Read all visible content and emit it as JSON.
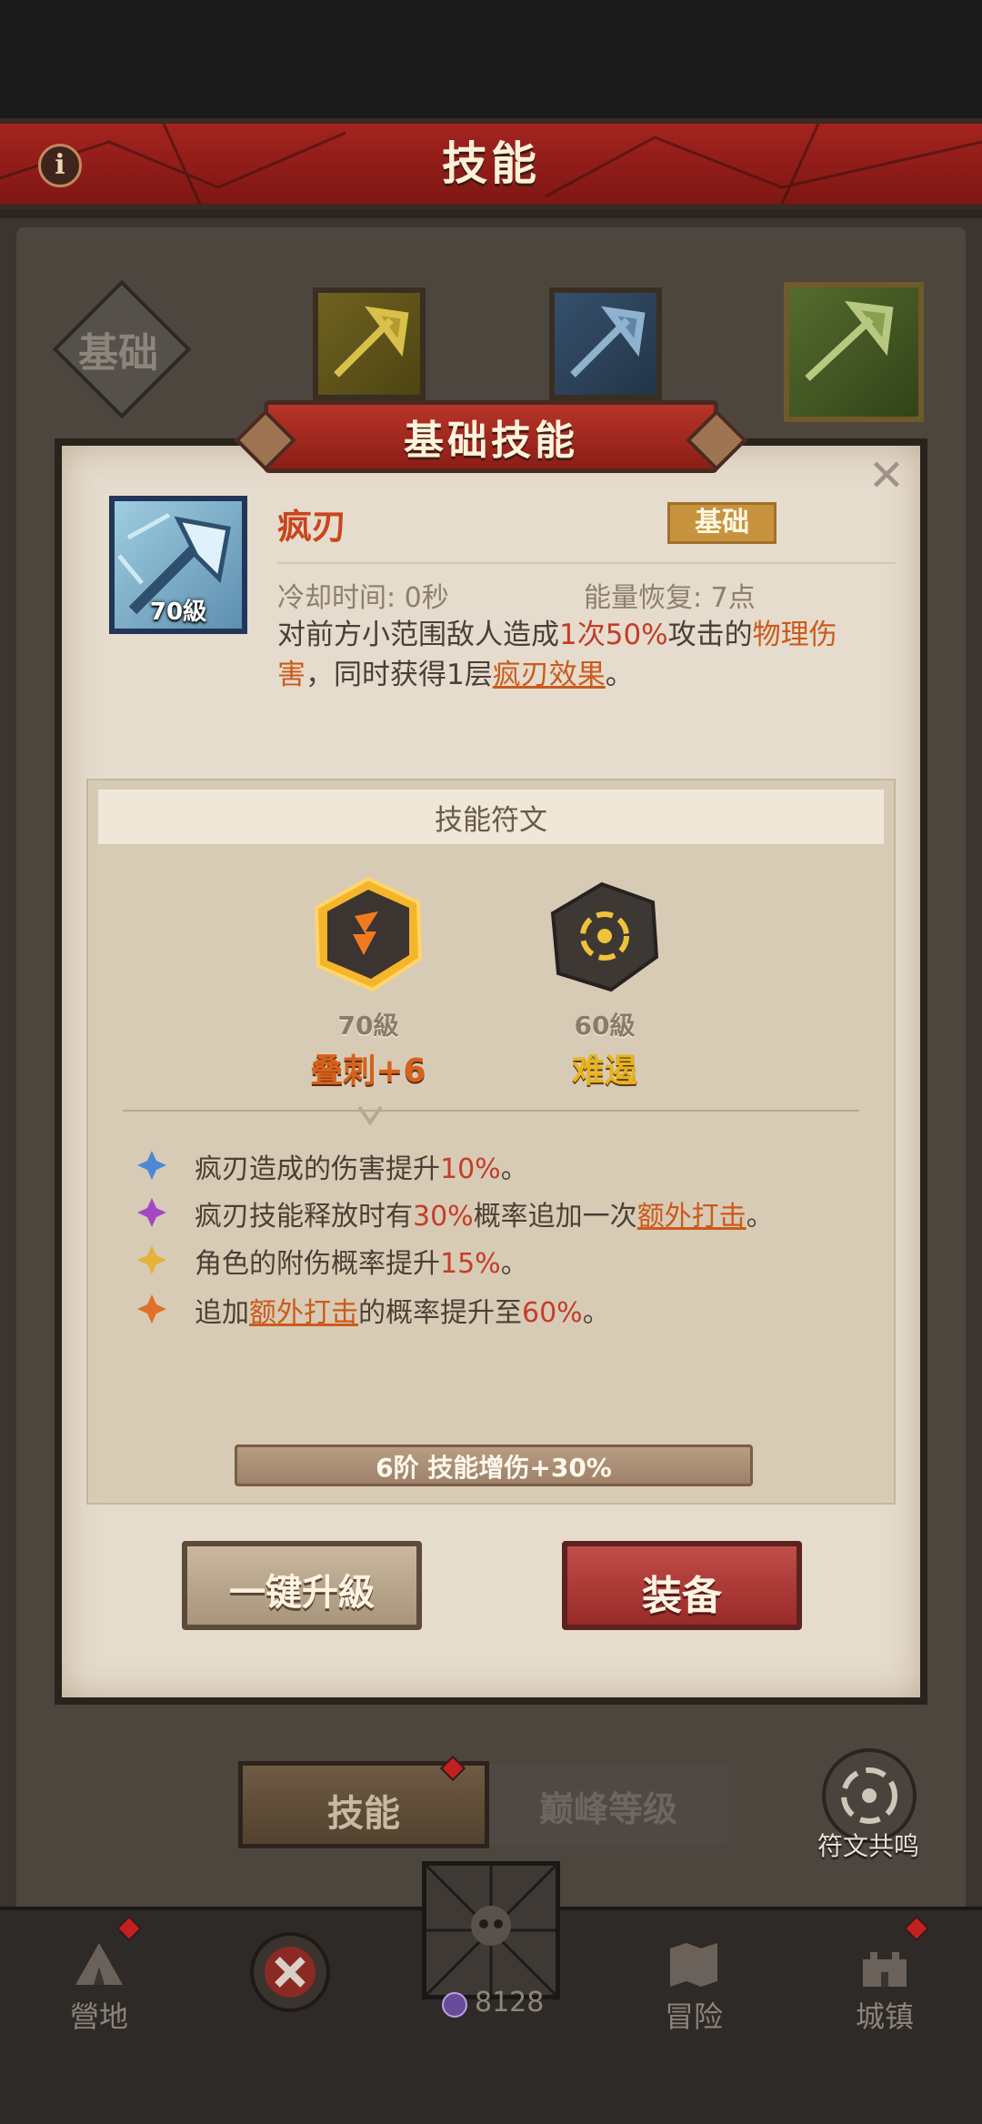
{
  "header": {
    "title": "技能"
  },
  "top_tabs": {
    "basic_label": "基础"
  },
  "modal": {
    "title": "基础技能",
    "close_symbol": "✕",
    "skill": {
      "name": "疯刃",
      "level": "70級",
      "badge": "基础",
      "cooldown": "冷却时间: 0秒",
      "energy": "能量恢复: 7点",
      "desc": {
        "p1": "对前方小范围敌人造成",
        "v1": "1次50%",
        "p2": "攻击的",
        "v2": "物理伤害",
        "p3": "，同时获得1层",
        "v3": "疯刃效果",
        "p4": "。"
      }
    },
    "runes": {
      "title": "技能符文",
      "items": [
        {
          "level": "70級",
          "name": "叠刺+6"
        },
        {
          "level": "60級",
          "name": "难遏"
        }
      ],
      "effects": [
        {
          "gem_color": "#4f86d6",
          "a": "疯刃造成的伤害提升",
          "v": "10%",
          "b": "。",
          "link": "",
          "c": ""
        },
        {
          "gem_color": "#a248c7",
          "a": "疯刃技能释放时有",
          "v": "30%",
          "b": "概率追加一次",
          "link": "额外打击",
          "c": "。"
        },
        {
          "gem_color": "#e3b33a",
          "a": "角色的附伤概率提升",
          "v": "15%",
          "b": "。",
          "link": "",
          "c": ""
        },
        {
          "gem_color": "#e0702a",
          "a": "追加",
          "link0": "额外打击",
          "b0": "的概率提升至",
          "v": "60%",
          "c": "。"
        }
      ],
      "tier": "6阶 技能增伤+30%"
    },
    "buttons": {
      "upgrade": "一键升級",
      "equip": "装备"
    }
  },
  "bottom_tabs": {
    "skill": "技能",
    "peak": "巅峰等级",
    "rune_resonance": "符文共鸣"
  },
  "nav": {
    "camp": "營地",
    "adventure": "冒险",
    "town": "城镇",
    "currency": "8128"
  },
  "colors": {
    "accent_red": "#a4231e",
    "highlight_red": "#c43c2c",
    "parchment": "#e6dccd"
  }
}
